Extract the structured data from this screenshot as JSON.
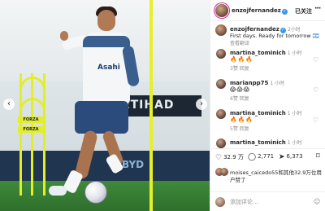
{
  "post": {
    "username": "enzojfernandez",
    "follow_label": "已关注",
    "more_label": "···"
  },
  "caption": {
    "username": "enzojfernandez",
    "time": "2小时",
    "text": "First days. Ready for tomorrow 🇦🇷",
    "translate": "查看翻译"
  },
  "photo": {
    "board_text": "ETIHAD",
    "jersey_sponsor": "Asahi",
    "drill_sign": "FORZA",
    "ad_right": "BYD",
    "prev_label": "‹",
    "next_label": "›"
  },
  "comments": [
    {
      "username": "martina_tominich",
      "time": "1 小时",
      "text": "🔥🔥🔥",
      "likes": "3赞",
      "reply": "回复"
    },
    {
      "username": "marianpp75",
      "time": "1 小时",
      "text": "😱😱😱",
      "likes": "6赞",
      "reply": "回复"
    },
    {
      "username": "martina_tominich",
      "time": "1 小时",
      "text": "🔥🔥🔥",
      "likes": "5赞",
      "reply": "回复"
    },
    {
      "username": "martina_tominich",
      "time": "1 小时",
      "text": "",
      "likes": "",
      "reply": ""
    }
  ],
  "actions": {
    "likes_count": "32.9 万",
    "comments_count": "2,771",
    "shares_count": "6,373"
  },
  "liked_by": {
    "line1": "moises_caicedo55和其他32.9万位用",
    "line2": "户赞了"
  },
  "compose": {
    "placeholder": "添加评论..."
  }
}
